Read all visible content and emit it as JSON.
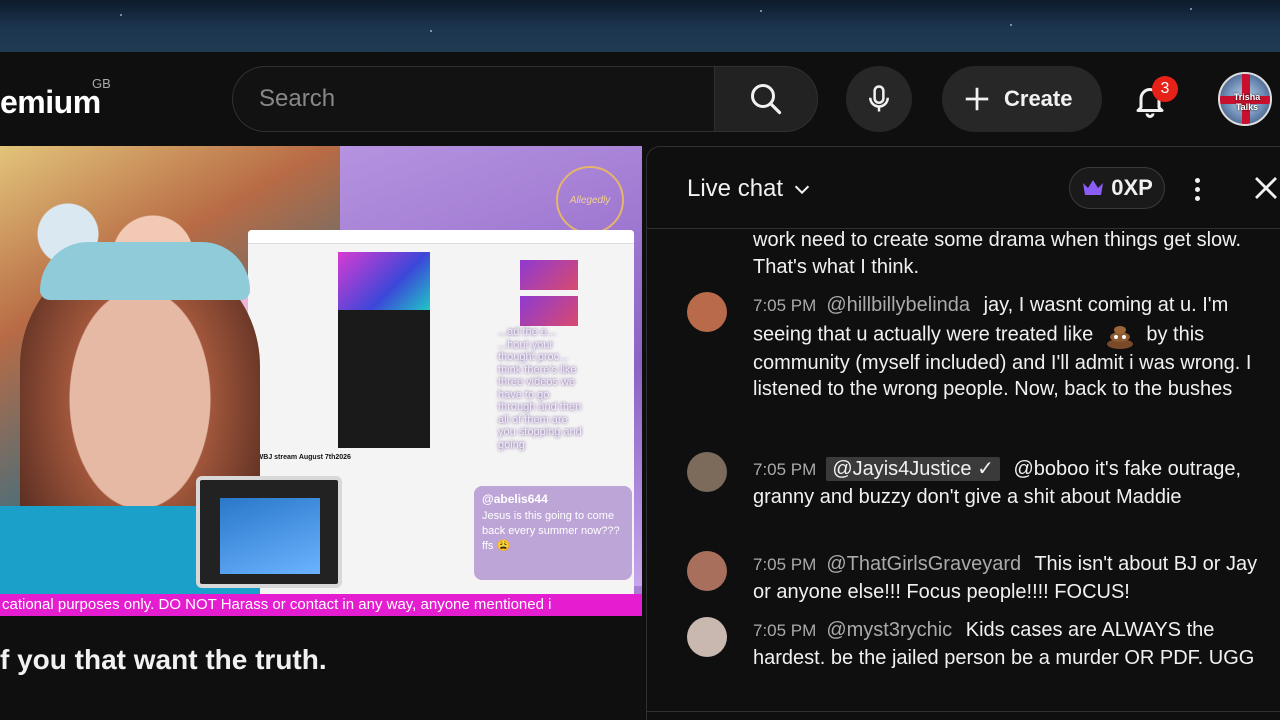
{
  "header": {
    "logo_text": "emium",
    "logo_region": "GB",
    "search_placeholder": "Search",
    "create_label": "Create",
    "notification_count": "3",
    "avatar_text": "Trisha Talks"
  },
  "video": {
    "seal_text": "Allegedly",
    "overlay_lines": "...ad the e... ...hout your thought proc... think there's like three videos we have to go through and then all of them are you stopping and going",
    "mini_title": "AWBJ stream August 7th2026",
    "overlay_card_user": "@abelis644",
    "overlay_card_text": "Jesus is this going to come back every summer now??? ffs 😩",
    "ticker_text": "cational purposes only. DO NOT Harass or contact in any way, anyone mentioned i",
    "caption_text": "f you that want the truth."
  },
  "chat": {
    "title": "Live chat",
    "xp_label": "0XP",
    "partial_message": "work need to create some drama when things get slow. That's what I think.",
    "messages": [
      {
        "time": "7:05 PM",
        "author": "@hillbillybelinda",
        "text_before": "jay, I wasnt coming at u. I'm seeing that u actually were treated like",
        "emoji": "poop-emoji",
        "text_after": "by this community (myself included) and I'll admit i was wrong. I listened to the wrong people. Now, back to the bushes",
        "avatar_color": "#b86a4a"
      },
      {
        "time": "7:05 PM",
        "author": "@Jayis4Justice ✓",
        "text": "@boboo it's fake outrage, granny and buzzy don't give a shit about Maddie",
        "avatar_color": "#7c6a5a"
      },
      {
        "time": "7:05 PM",
        "author": "@ThatGirlsGraveyard",
        "text": "This isn't about BJ or Jay or anyone else!!! Focus people!!!! FOCUS!",
        "avatar_color": "#a86f5c"
      },
      {
        "time": "7:05 PM",
        "author": "@myst3rychic",
        "text": "Kids cases are ALWAYS the hardest. be the jailed person be a murder OR PDF. UGG",
        "avatar_color": "#c9b8b0"
      }
    ]
  },
  "colors": {
    "background": "#0f0f0f",
    "notification_badge": "#e62117",
    "ticker": "#e41ed0",
    "crown": "#8b5cf6"
  }
}
